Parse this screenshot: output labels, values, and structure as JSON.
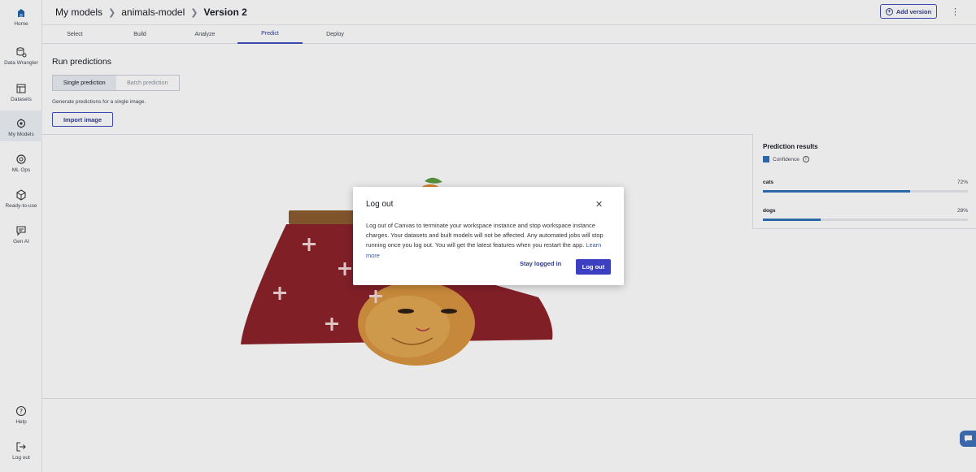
{
  "sidebar": {
    "items": [
      {
        "label": "Home",
        "icon": "home-icon"
      },
      {
        "label": "Data Wrangler",
        "icon": "data-wrangler-icon"
      },
      {
        "label": "Datasets",
        "icon": "datasets-icon"
      },
      {
        "label": "My Models",
        "icon": "my-models-icon"
      },
      {
        "label": "ML Ops",
        "icon": "ml-ops-icon"
      },
      {
        "label": "Ready-to-use",
        "icon": "ready-to-use-icon"
      },
      {
        "label": "Gen AI",
        "icon": "gen-ai-icon"
      },
      {
        "label": "Help",
        "icon": "help-icon"
      },
      {
        "label": "Log out",
        "icon": "logout-icon"
      }
    ]
  },
  "header": {
    "crumb1": "My models",
    "crumb2": "animals-model",
    "crumb3": "Version 2",
    "add_version": "Add version"
  },
  "tabs": [
    "Select",
    "Build",
    "Analyze",
    "Predict",
    "Deploy"
  ],
  "main": {
    "title": "Run predictions",
    "seg_single": "Single prediction",
    "seg_batch": "Batch prediction",
    "hint": "Generate predictions for a single image.",
    "import_label": "Import image"
  },
  "results": {
    "title": "Prediction results",
    "legend": "Confidence",
    "rows": [
      {
        "name": "cats",
        "pct": "72%",
        "value": 0.72
      },
      {
        "name": "dogs",
        "pct": "28%",
        "value": 0.28
      }
    ]
  },
  "modal": {
    "title": "Log out",
    "body": "Log out of Canvas to terminate your workspace instance and stop workspace instance charges. Your datasets and built models will not be affected. Any automated jobs will stop running once you log out. You will get the latest features when you restart the app.",
    "link": "Learn more",
    "stay": "Stay logged in",
    "logout": "Log out"
  },
  "colors": {
    "accent": "#3d3fc2",
    "bar": "#2b6fb6"
  }
}
